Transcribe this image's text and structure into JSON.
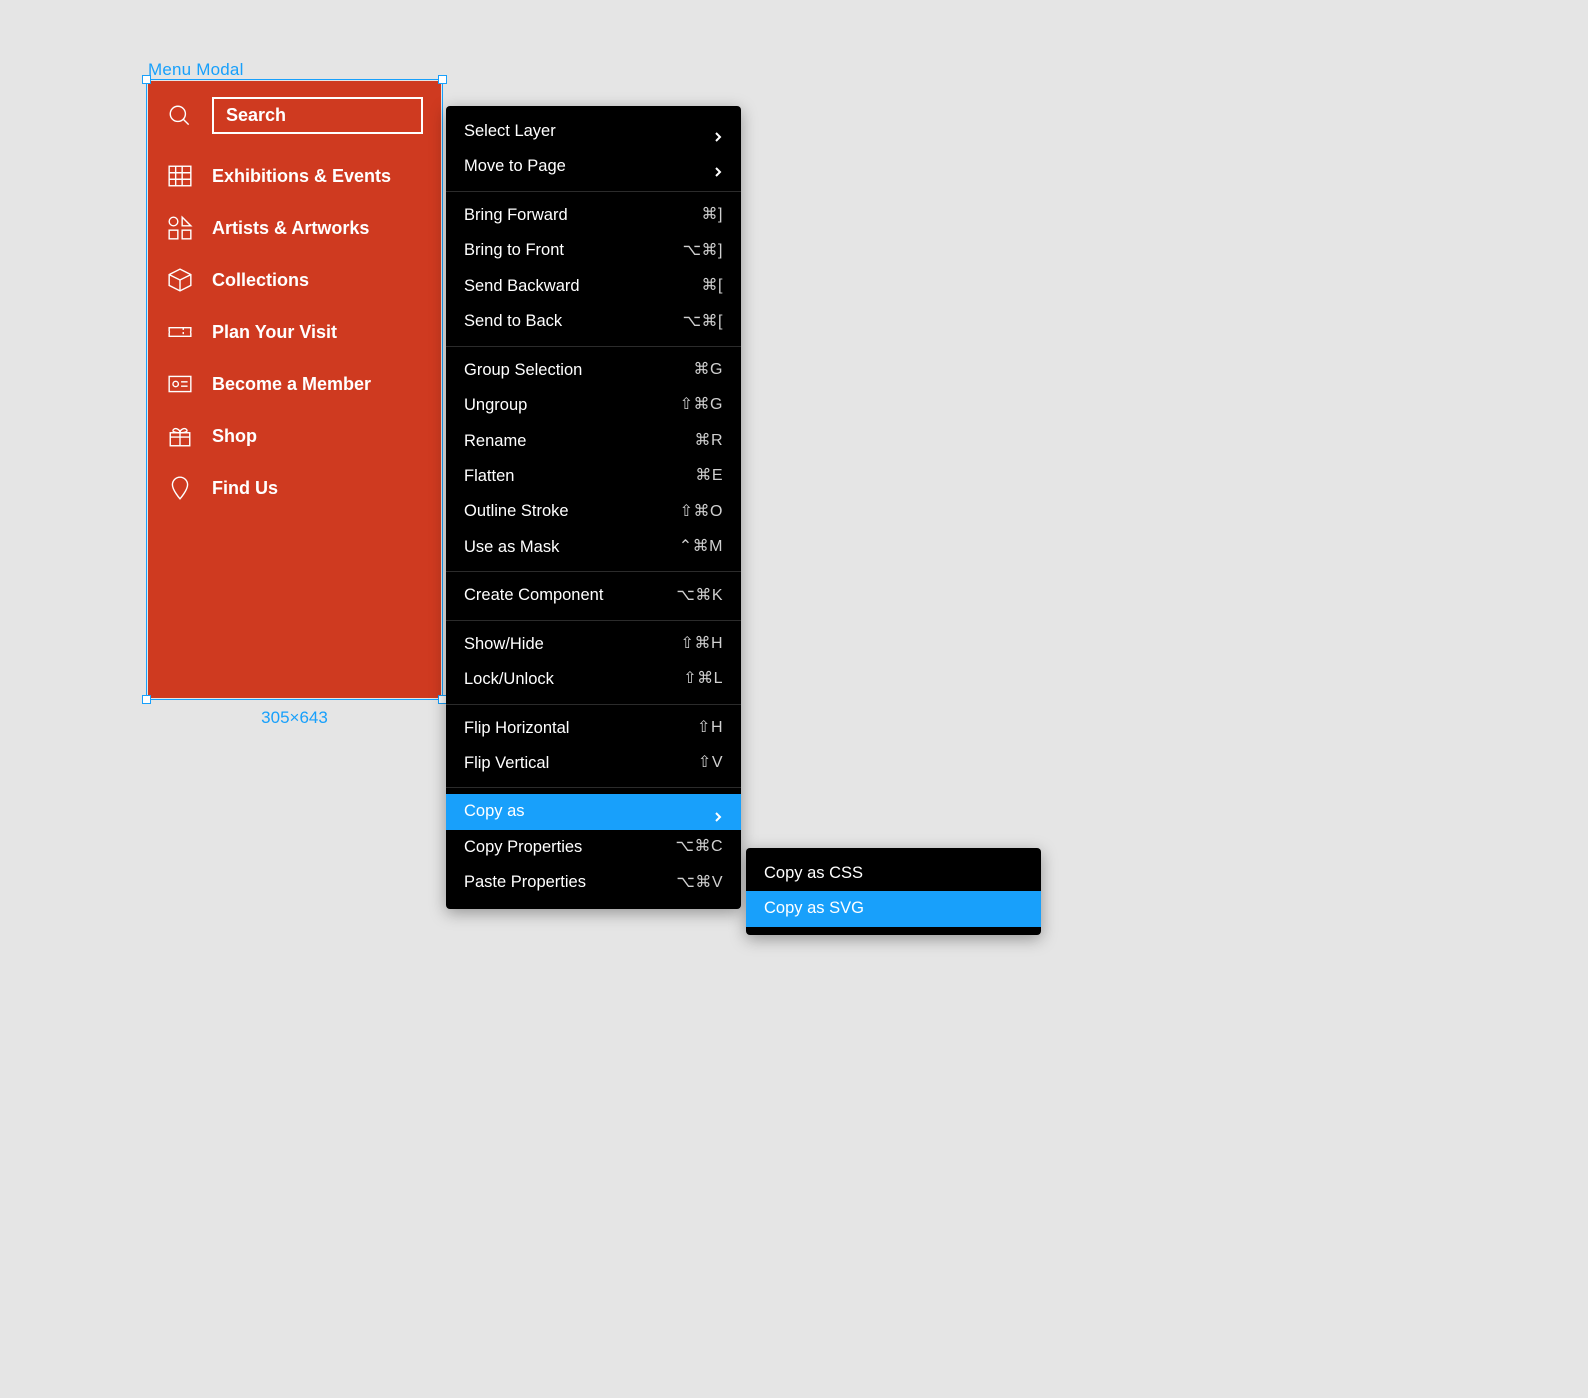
{
  "frame": {
    "label": "Menu Modal",
    "dimensions": "305×643"
  },
  "menu_modal": {
    "search_placeholder": "Search",
    "items": [
      {
        "label": "Exhibitions & Events",
        "icon": "calendar-icon"
      },
      {
        "label": "Artists & Artworks",
        "icon": "shapes-icon"
      },
      {
        "label": "Collections",
        "icon": "cube-icon"
      },
      {
        "label": "Plan Your Visit",
        "icon": "ticket-icon"
      },
      {
        "label": "Become a Member",
        "icon": "id-card-icon"
      },
      {
        "label": "Shop",
        "icon": "gift-icon"
      },
      {
        "label": "Find Us",
        "icon": "pin-icon"
      }
    ]
  },
  "context_menu": {
    "groups": [
      [
        {
          "label": "Select Layer",
          "shortcut": "",
          "submenu": true
        },
        {
          "label": "Move to Page",
          "shortcut": "",
          "submenu": true
        }
      ],
      [
        {
          "label": "Bring Forward",
          "shortcut": "⌘]"
        },
        {
          "label": "Bring to Front",
          "shortcut": "⌥⌘]"
        },
        {
          "label": "Send Backward",
          "shortcut": "⌘["
        },
        {
          "label": "Send to Back",
          "shortcut": "⌥⌘["
        }
      ],
      [
        {
          "label": "Group Selection",
          "shortcut": "⌘G"
        },
        {
          "label": "Ungroup",
          "shortcut": "⇧⌘G"
        },
        {
          "label": "Rename",
          "shortcut": "⌘R"
        },
        {
          "label": "Flatten",
          "shortcut": "⌘E"
        },
        {
          "label": "Outline Stroke",
          "shortcut": "⇧⌘O"
        },
        {
          "label": "Use as Mask",
          "shortcut": "⌃⌘M"
        }
      ],
      [
        {
          "label": "Create Component",
          "shortcut": "⌥⌘K"
        }
      ],
      [
        {
          "label": "Show/Hide",
          "shortcut": "⇧⌘H"
        },
        {
          "label": "Lock/Unlock",
          "shortcut": "⇧⌘L"
        }
      ],
      [
        {
          "label": "Flip Horizontal",
          "shortcut": "⇧H"
        },
        {
          "label": "Flip Vertical",
          "shortcut": "⇧V"
        }
      ],
      [
        {
          "label": "Copy as",
          "shortcut": "",
          "submenu": true,
          "highlight": true
        },
        {
          "label": "Copy Properties",
          "shortcut": "⌥⌘C"
        },
        {
          "label": "Paste Properties",
          "shortcut": "⌥⌘V"
        }
      ]
    ]
  },
  "submenu": {
    "items": [
      {
        "label": "Copy as CSS",
        "highlight": false
      },
      {
        "label": "Copy as SVG",
        "highlight": true
      }
    ]
  }
}
